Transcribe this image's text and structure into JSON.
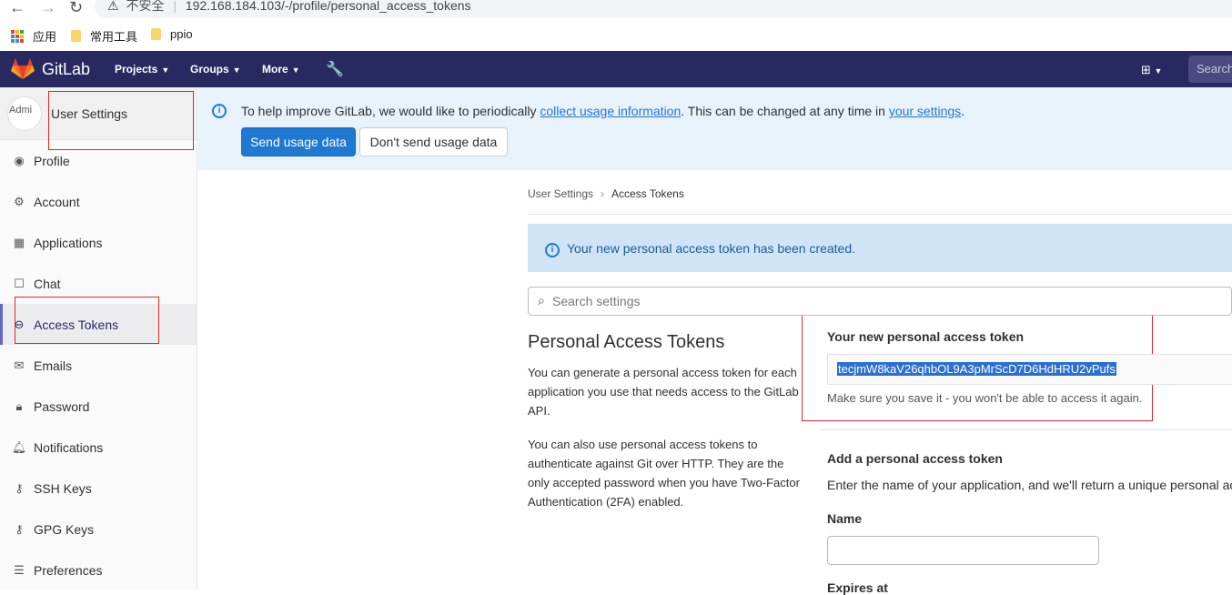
{
  "browser": {
    "security_label": "不安全",
    "url": "192.168.184.103/-/profile/personal_access_tokens",
    "bookmarks": [
      "应用",
      "常用工具",
      "ppio"
    ]
  },
  "topnav": {
    "brand": "GitLab",
    "items": [
      "Projects",
      "Groups",
      "More"
    ],
    "search_placeholder": "Search"
  },
  "sidebar": {
    "avatar_alt": "Admi",
    "title": "User Settings",
    "items": [
      {
        "label": "Profile",
        "icon": "profile-icon"
      },
      {
        "label": "Account",
        "icon": "account-icon"
      },
      {
        "label": "Applications",
        "icon": "applications-icon"
      },
      {
        "label": "Chat",
        "icon": "chat-icon"
      },
      {
        "label": "Access Tokens",
        "icon": "token-icon",
        "active": true
      },
      {
        "label": "Emails",
        "icon": "email-icon"
      },
      {
        "label": "Password",
        "icon": "lock-icon"
      },
      {
        "label": "Notifications",
        "icon": "bell-icon"
      },
      {
        "label": "SSH Keys",
        "icon": "key-icon"
      },
      {
        "label": "GPG Keys",
        "icon": "key-icon"
      },
      {
        "label": "Preferences",
        "icon": "preferences-icon"
      }
    ]
  },
  "banner": {
    "text_before": "To help improve GitLab, we would like to periodically ",
    "link1": "collect usage information",
    "text_middle": ". This can be changed at any time in ",
    "link2": "your settings",
    "text_after": ".",
    "send_button": "Send usage data",
    "dont_send_button": "Don't send usage data"
  },
  "breadcrumb": {
    "parent": "User Settings",
    "current": "Access Tokens"
  },
  "alert": {
    "text": "Your new personal access token has been created."
  },
  "search": {
    "placeholder": "Search settings"
  },
  "section": {
    "title": "Personal Access Tokens",
    "desc1": "You can generate a personal access token for each application you use that needs access to the GitLab API.",
    "desc2": "You can also use personal access tokens to authenticate against Git over HTTP. They are the only accepted password when you have Two-Factor Authentication (2FA) enabled."
  },
  "token": {
    "label": "Your new personal access token",
    "value": "tecjmW8kaV26qhbOL9A3pMrScD7D6HdHRU2vPufs",
    "help": "Make sure you save it - you won't be able to access it again."
  },
  "add_token": {
    "title": "Add a personal access token",
    "desc": "Enter the name of your application, and we'll return a unique personal ac",
    "name_label": "Name",
    "expires_label": "Expires at"
  },
  "colors": {
    "nav_bg": "#292961",
    "primary": "#1f78d1",
    "highlight_box": "#e0282e"
  }
}
